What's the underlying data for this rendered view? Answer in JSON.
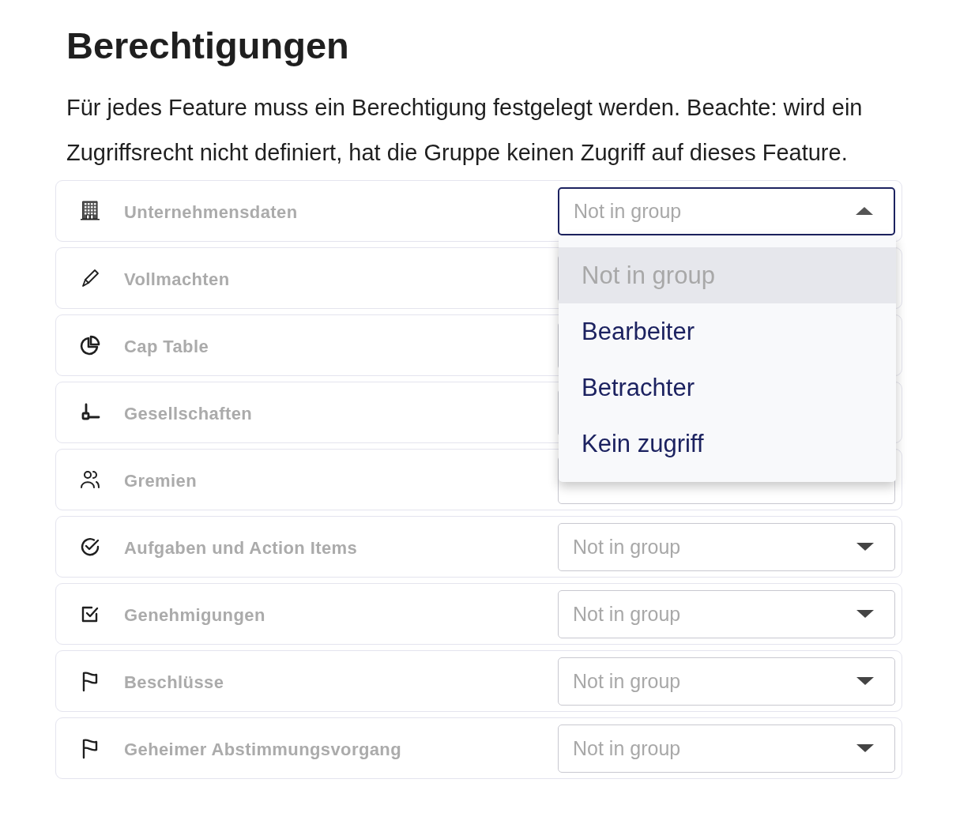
{
  "title": "Berechtigungen",
  "description": "Für jedes Feature muss ein Berechtigung festgelegt werden. Beachte: wird ein Zugriffsrecht nicht definiert, hat die Gruppe keinen Zugriff auf dieses Feature.",
  "features": [
    {
      "kind": "building",
      "label": "Unternehmensdaten",
      "select": {
        "placeholder": "Not in group",
        "open": true,
        "options": [
          {
            "label": "Not in group",
            "selected": true
          },
          {
            "label": "Bearbeiter",
            "selected": false
          },
          {
            "label": "Betrachter",
            "selected": false
          },
          {
            "label": "Kein zugriff",
            "selected": false
          }
        ]
      }
    },
    {
      "kind": "pen",
      "label": "Vollmachten",
      "select": {
        "open": false
      }
    },
    {
      "kind": "pie",
      "label": "Cap Table",
      "select": {
        "open": false
      }
    },
    {
      "kind": "hook",
      "label": "Gesellschaften",
      "select": {
        "open": false
      }
    },
    {
      "kind": "users",
      "label": "Gremien",
      "select": {
        "open": false
      }
    },
    {
      "kind": "check-circle",
      "label": "Aufgaben und Action Items",
      "select": {
        "placeholder": "Not in group",
        "open": false
      }
    },
    {
      "kind": "check-square",
      "label": "Genehmigungen",
      "select": {
        "placeholder": "Not in group",
        "open": false
      }
    },
    {
      "kind": "flag",
      "label": "Beschlüsse",
      "select": {
        "placeholder": "Not in group",
        "open": false
      }
    },
    {
      "kind": "flag",
      "label": "Geheimer Abstimmungsvorgang",
      "select": {
        "placeholder": "Not in group",
        "open": false
      }
    }
  ]
}
